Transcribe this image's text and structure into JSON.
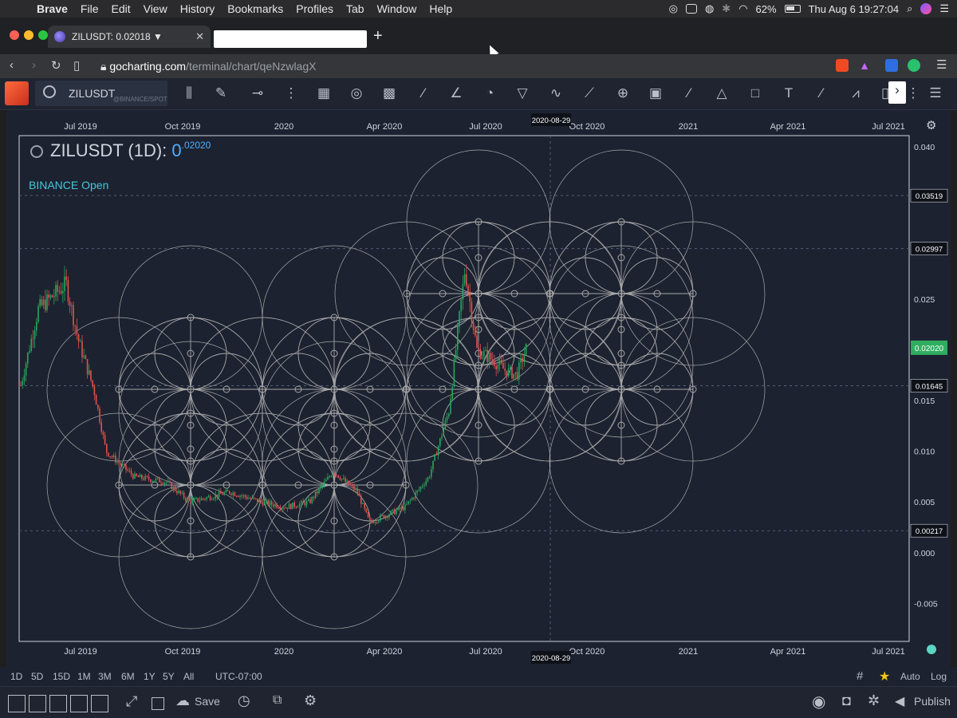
{
  "menubar": {
    "app_name": "Brave",
    "items": [
      "File",
      "Edit",
      "View",
      "History",
      "Bookmarks",
      "Profiles",
      "Tab",
      "Window",
      "Help"
    ],
    "battery": "62%",
    "datetime": "Thu Aug 6  19:27:04"
  },
  "browser": {
    "tab_title": "ZILUSDT: 0.02018 ▼",
    "url_domain": "gocharting.com",
    "url_path": "/terminal/chart/qeNzwlagX"
  },
  "toolbar": {
    "symbol": "ZILUSDT",
    "exchange": "@BINANCE/SPOT"
  },
  "chart": {
    "title_prefix": "ZILUSDT (1D):",
    "price_main": "0",
    "price_sup": ".02020",
    "legend_label": "BINANCE Open",
    "crosshair_date": "2020-08-29",
    "x_ticks": [
      "Jul 2019",
      "Oct 2019",
      "2020",
      "Apr 2020",
      "Jul 2020",
      "Oct 2020",
      "2021",
      "Apr 2021",
      "Jul 2021"
    ],
    "y_ticks": [
      "0.040",
      "0.035",
      "0.030",
      "0.025",
      "0.020",
      "0.015",
      "0.010",
      "0.005",
      "0.000",
      "-0.005"
    ],
    "price_labels": [
      "0.03519",
      "0.02997",
      "0.01645",
      "0.00217"
    ],
    "last_price_label": "0.02020",
    "colors": {
      "up": "#26a65b",
      "down": "#e0524f",
      "last_price_bg": "#2fae60",
      "circles": "#a8a8a8",
      "background": "#1c2230"
    }
  },
  "intervals": {
    "items": [
      "1D",
      "5D",
      "15D",
      "1M",
      "3M",
      "6M",
      "1Y",
      "5Y",
      "All"
    ],
    "timezone": "UTC-07:00",
    "auto": "Auto",
    "log": "Log"
  },
  "footer": {
    "save": "Save",
    "publish": "Publish"
  }
}
